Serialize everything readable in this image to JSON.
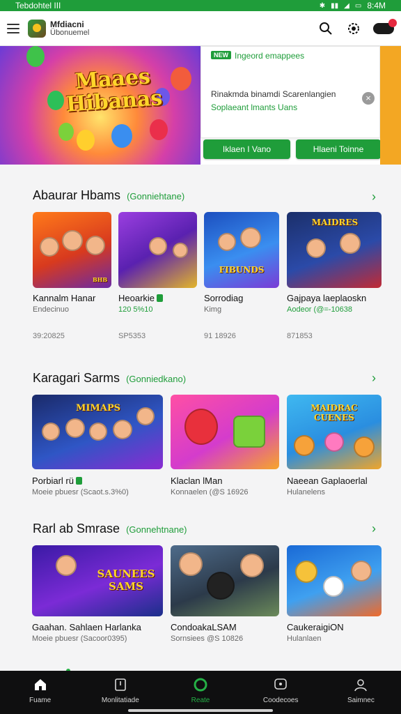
{
  "status_bar": {
    "carrier": "Tebdohtel III",
    "time": "8:4M"
  },
  "app_bar": {
    "title": "Mfdiacni",
    "subtitle": "Übonuemel"
  },
  "hero": {
    "art_title": "Maaes Hibanas",
    "badge": "NEW",
    "badge_text": "Ingeord emappees",
    "line1": "Rinakmda binamdi Scarenlangien",
    "line2": "Soplaeant lmants Uans",
    "button_left": "Iklaen I Vano",
    "button_right": "Hlaeni Toinne"
  },
  "sections": [
    {
      "title": "Abaurar Hbams",
      "subtitle": "(Gonniehtane)",
      "cards": [
        {
          "title": "Kannalm Hanar",
          "sub": "Endecinuo",
          "meta": "39:20825",
          "badge_text": "BHB"
        },
        {
          "title": "Heoarkie",
          "sub": "120 5%10",
          "meta": "SP5353"
        },
        {
          "title": "Sorrodiag",
          "sub": "Kimg",
          "meta": "91 18926",
          "art_text": "FIBUNDS"
        },
        {
          "title": "Gajpaya laeplaoskn",
          "sub": "Aodeor (@=-10638",
          "meta": "871853",
          "art_text": "MAIDRES"
        }
      ]
    },
    {
      "title": "Karagari Sarms",
      "subtitle": "(Gonniedkano)",
      "cards": [
        {
          "title": "Porbiarl rü",
          "sub": "Moeie pbuesr (Scaot.s.3%0)",
          "art_text": "MIMAPS"
        },
        {
          "title": "Klaclan lMan",
          "sub": "Konnaelen (@S 16926"
        },
        {
          "title": "Naeean Gaplaoerlal",
          "sub": "Hulanelens",
          "art_text": "MAIDRAC CUENES"
        }
      ]
    },
    {
      "title": "Rarl ab Smrase",
      "subtitle": "(Gonnehtnane)",
      "cards": [
        {
          "title": "Gaahan. Sahlaen Harlanka",
          "sub": "Moeie pbuesr (Sacoor0395)",
          "art_text": "SAUNEES SAMS"
        },
        {
          "title": "CondoakaLSAM",
          "sub": "Sornsiees @S 10826"
        },
        {
          "title": "CaukeraigiON",
          "sub": "Hulanlaen"
        }
      ]
    }
  ],
  "bottom_nav": [
    {
      "label": "Fuame",
      "icon": "home-icon"
    },
    {
      "label": "Monlitatiade",
      "icon": "library-icon"
    },
    {
      "label": "Reate",
      "icon": "ring-icon"
    },
    {
      "label": "Coodecoes",
      "icon": "chat-icon"
    },
    {
      "label": "Saimnec",
      "icon": "person-icon"
    }
  ],
  "colors": {
    "accent": "#1f9d3a",
    "nav_bg": "#0f0f10",
    "hero_stripe": "#f3a723"
  }
}
